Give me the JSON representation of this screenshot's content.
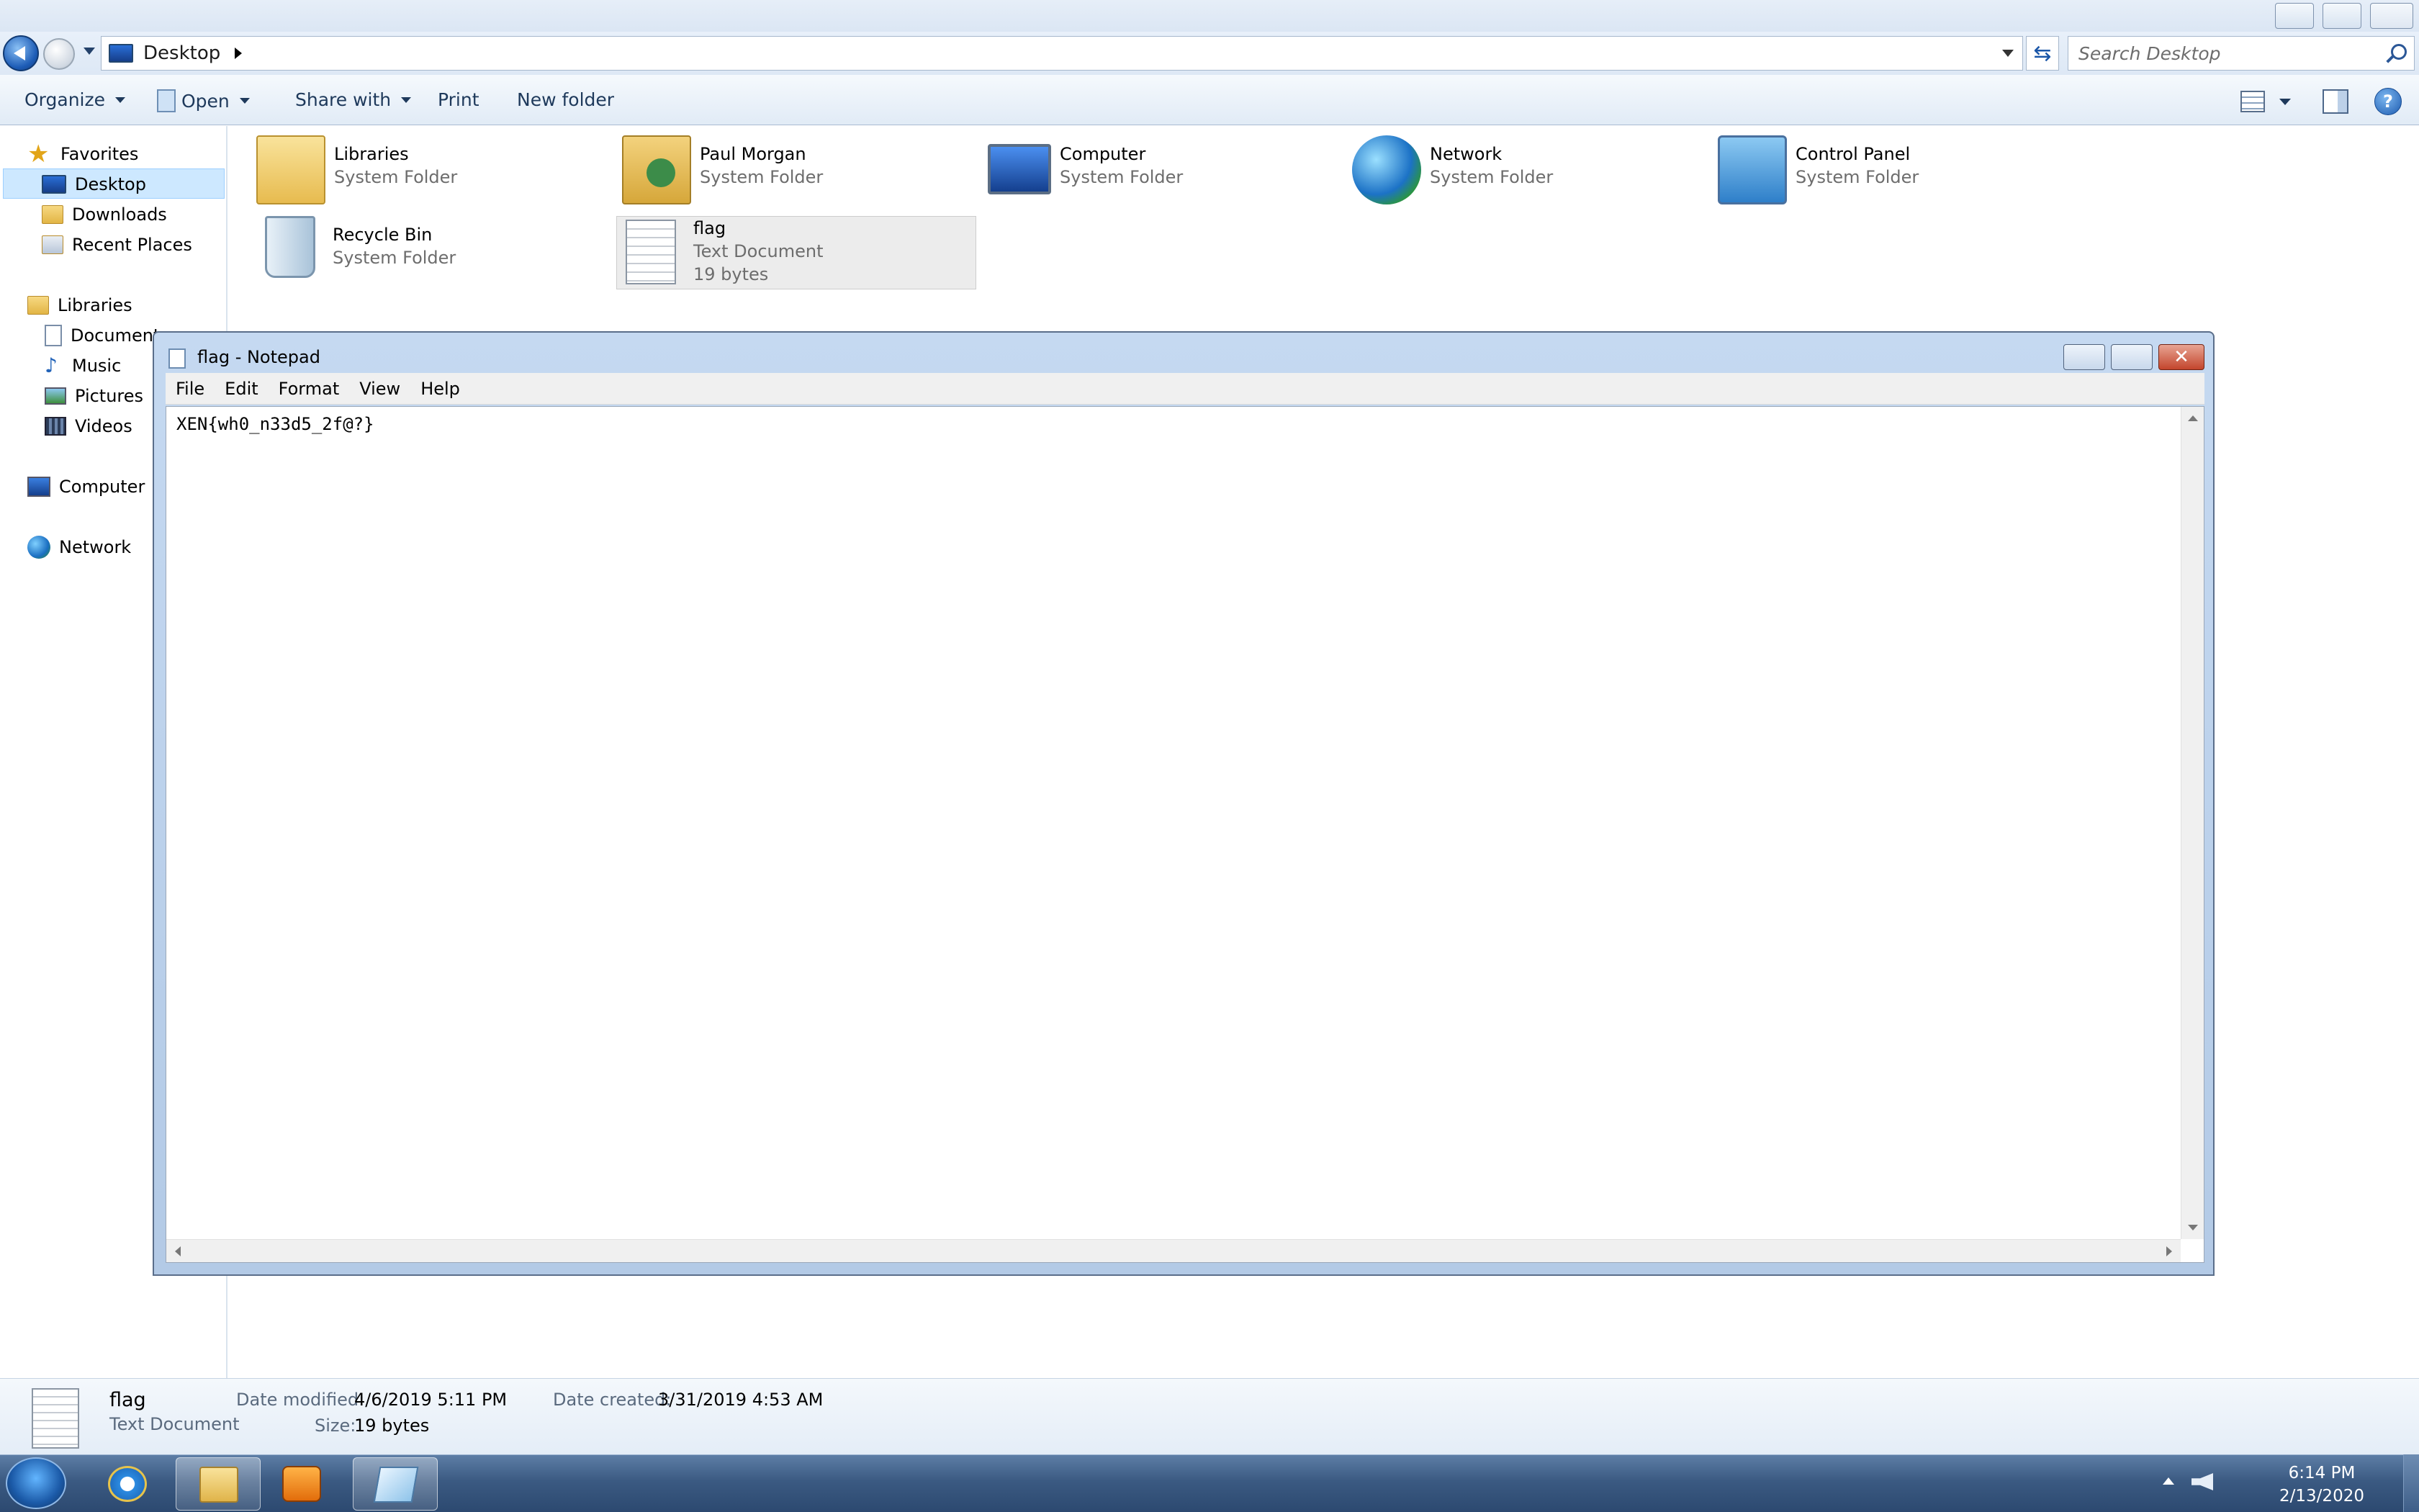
{
  "address": {
    "path": "Desktop",
    "search_placeholder": "Search Desktop"
  },
  "toolbar": {
    "organize": "Organize",
    "open": "Open",
    "share_with": "Share with",
    "print": "Print",
    "new_folder": "New folder"
  },
  "nav": {
    "favorites": "Favorites",
    "desktop": "Desktop",
    "downloads": "Downloads",
    "recent_places": "Recent Places",
    "libraries": "Libraries",
    "documents": "Document",
    "music": "Music",
    "pictures": "Pictures",
    "videos": "Videos",
    "computer": "Computer",
    "network": "Network"
  },
  "items": [
    {
      "name": "Libraries",
      "type": "System Folder",
      "icon": "libraries-folder-icon"
    },
    {
      "name": "Paul Morgan",
      "type": "System Folder",
      "icon": "user-folder-icon"
    },
    {
      "name": "Computer",
      "type": "System Folder",
      "icon": "computer-icon"
    },
    {
      "name": "Network",
      "type": "System Folder",
      "icon": "network-icon"
    },
    {
      "name": "Control Panel",
      "type": "System Folder",
      "icon": "control-panel-icon"
    },
    {
      "name": "Recycle Bin",
      "type": "System Folder",
      "icon": "recycle-bin-icon"
    },
    {
      "name": "flag",
      "type": "Text Document",
      "size": "19 bytes",
      "icon": "text-document-icon"
    }
  ],
  "notepad": {
    "title": "flag - Notepad",
    "menu": [
      "File",
      "Edit",
      "Format",
      "View",
      "Help"
    ],
    "content": "XEN{wh0_n33d5_2f@?}"
  },
  "details": {
    "name": "flag",
    "type": "Text Document",
    "date_modified_label": "Date modified:",
    "date_modified": "4/6/2019 5:11 PM",
    "date_created_label": "Date created:",
    "date_created": "3/31/2019 4:53 AM",
    "size_label": "Size:",
    "size": "19 bytes"
  },
  "taskbar": {
    "time": "6:14 PM",
    "date": "2/13/2020"
  },
  "colors": {
    "selection": "#cde8ff",
    "taskbar": "#3b5a82",
    "close_red": "#c3452c"
  }
}
